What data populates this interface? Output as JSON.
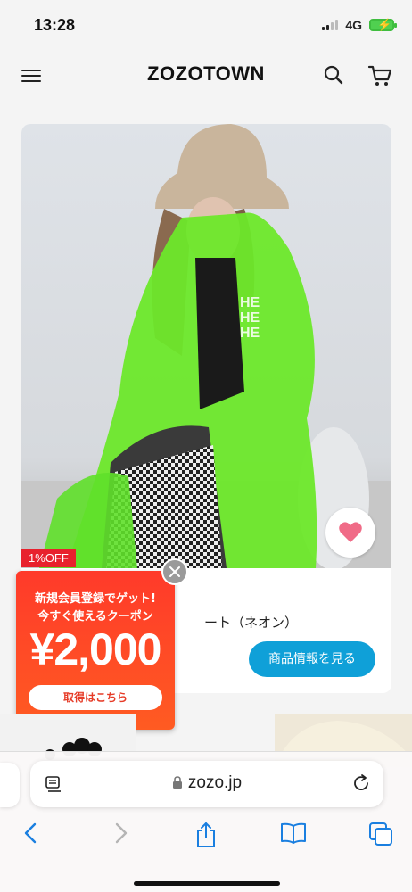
{
  "status_bar": {
    "time": "13:28",
    "network": "4G"
  },
  "nav": {
    "logo": "ZOZOTOWN",
    "menu_icon": "hamburger-menu-icon",
    "search_icon": "search-icon",
    "cart_icon": "cart-icon"
  },
  "product": {
    "discount_badge": "1%OFF",
    "title_partial": "ート（ネオン）",
    "detail_button": "商品情報を見る",
    "favorite_icon": "heart-icon",
    "accent_color": "#0fa0d8",
    "heart_color": "#f06b87"
  },
  "coupon_popup": {
    "line1": "新規会員登録でゲット!",
    "line2": "今すぐ使えるクーポン",
    "amount": "¥2,000",
    "get_button": "取得はこちら",
    "close_icon": "close-icon",
    "color": "#ff4a25"
  },
  "browser": {
    "url": "zozo.jp",
    "page_icon": "page-menu-icon",
    "reload_icon": "reload-icon",
    "toolbar": [
      "back-icon",
      "forward-icon",
      "share-icon",
      "bookmarks-icon",
      "tabs-icon"
    ]
  }
}
